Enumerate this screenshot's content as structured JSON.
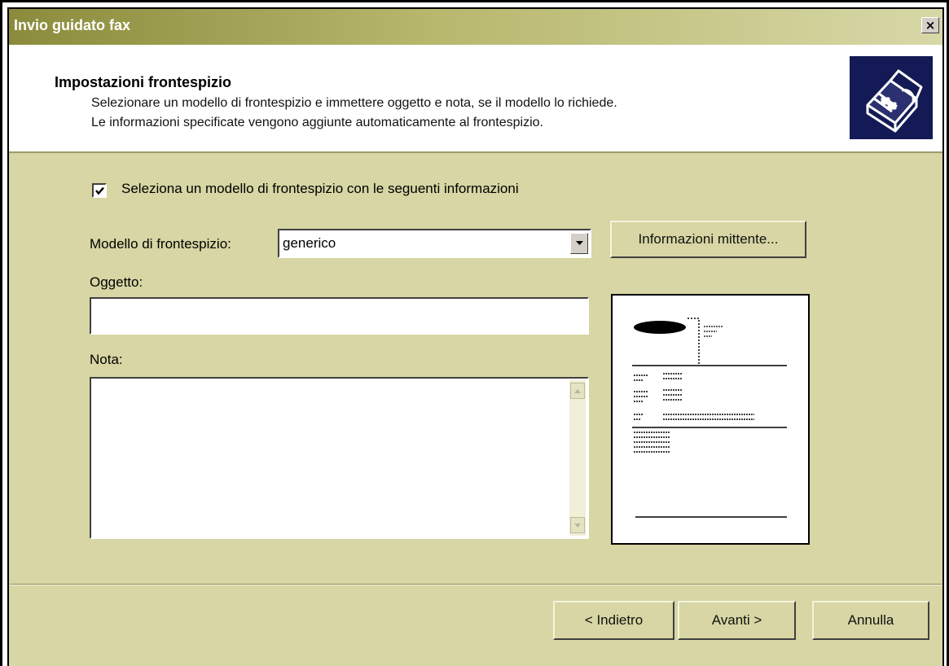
{
  "window": {
    "title": "Invio guidato fax",
    "close_glyph": "×"
  },
  "header": {
    "title": "Impostazioni frontespizio",
    "line1": "Selezionare un modello di frontespizio e immettere oggetto e nota, se il modello lo richiede.",
    "line2": "Le informazioni specificate vengono aggiunte automaticamente al frontespizio.",
    "icon": "fax-machine-icon"
  },
  "form": {
    "use_template_label": "Seleziona un modello di frontespizio con le seguenti informazioni",
    "use_template_checked": true,
    "template_label": "Modello di frontespizio:",
    "template_value": "generico",
    "sender_info_button": "Informazioni mittente...",
    "subject_label": "Oggetto:",
    "subject_value": "",
    "note_label": "Nota:",
    "note_value": ""
  },
  "footer": {
    "back_button": "< Indietro",
    "next_button": "Avanti >",
    "cancel_button": "Annulla"
  },
  "colors": {
    "dialog_bg": "#d7d6a4",
    "titlebar_start": "#8b8b3d",
    "titlebar_end": "#d8d8a8",
    "icon_bg": "#141a55"
  }
}
